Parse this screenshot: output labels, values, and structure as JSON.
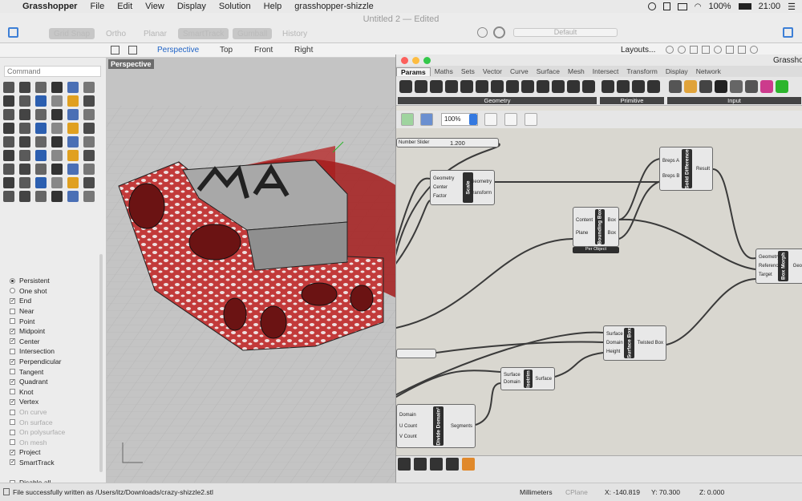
{
  "menubar": {
    "app": "Grasshopper",
    "items": [
      "File",
      "Edit",
      "View",
      "Display",
      "Solution",
      "Help",
      "grasshopper-shizzle"
    ],
    "battery": "100%",
    "time": "21:00"
  },
  "rhino": {
    "title": "Untitled 2 — Edited",
    "toolbar": [
      "Grid Snap",
      "Ortho",
      "Planar",
      "SmartTrack",
      "Gumball",
      "History"
    ],
    "layer": "Default",
    "tabs": [
      "Perspective",
      "Top",
      "Front",
      "Right"
    ],
    "layouts_label": "Layouts...",
    "command_placeholder": "Command",
    "viewport_label": "Perspective",
    "snaps": [
      {
        "label": "Persistent",
        "type": "radio",
        "on": true
      },
      {
        "label": "One shot",
        "type": "radio",
        "on": false
      },
      {
        "label": "End",
        "type": "check",
        "on": true
      },
      {
        "label": "Near",
        "type": "check",
        "on": false
      },
      {
        "label": "Point",
        "type": "check",
        "on": false
      },
      {
        "label": "Midpoint",
        "type": "check",
        "on": true
      },
      {
        "label": "Center",
        "type": "check",
        "on": true
      },
      {
        "label": "Intersection",
        "type": "check",
        "on": false
      },
      {
        "label": "Perpendicular",
        "type": "check",
        "on": true
      },
      {
        "label": "Tangent",
        "type": "check",
        "on": false
      },
      {
        "label": "Quadrant",
        "type": "check",
        "on": true
      },
      {
        "label": "Knot",
        "type": "check",
        "on": false
      },
      {
        "label": "Vertex",
        "type": "check",
        "on": true
      },
      {
        "label": "On curve",
        "type": "check",
        "on": false,
        "dim": true
      },
      {
        "label": "On surface",
        "type": "check",
        "on": false,
        "dim": true
      },
      {
        "label": "On polysurface",
        "type": "check",
        "on": false,
        "dim": true
      },
      {
        "label": "On mesh",
        "type": "check",
        "on": false,
        "dim": true
      },
      {
        "label": "Project",
        "type": "check",
        "on": true
      },
      {
        "label": "SmartTrack",
        "type": "check",
        "on": true
      },
      {
        "label": "",
        "type": "spacer"
      },
      {
        "label": "Disable all",
        "type": "check",
        "on": false
      }
    ]
  },
  "status": {
    "message": "File successfully written as /Users/itz/Downloads/crazy-shizzle2.stl",
    "units": "Millimeters",
    "cplane": "CPlane",
    "x": "X: -140.819",
    "y": "Y: 70.300",
    "z": "Z: 0.000"
  },
  "grasshopper": {
    "title": "Grassho",
    "tabs": [
      "Params",
      "Maths",
      "Sets",
      "Vector",
      "Curve",
      "Surface",
      "Mesh",
      "Intersect",
      "Transform",
      "Display",
      "Network"
    ],
    "ribbon_groups": [
      "Geometry",
      "Primitive",
      "Input"
    ],
    "zoom": "100%",
    "slider": {
      "label": "Number Slider",
      "value": "1.200"
    },
    "components": [
      {
        "id": "scale",
        "name": "Scale",
        "inputs": [
          "Geometry",
          "Center",
          "Factor"
        ],
        "outputs": [
          "Geometry",
          "Transform"
        ]
      },
      {
        "id": "bbox",
        "name": "Bounding Box",
        "inputs": [
          "Content",
          "Plane"
        ],
        "outputs": [
          "Box",
          "Box"
        ],
        "tag": "Per Object"
      },
      {
        "id": "soliddiff",
        "name": "Solid Difference",
        "inputs": [
          "Breps A",
          "Breps B"
        ],
        "outputs": [
          "Result"
        ]
      },
      {
        "id": "boxmorph",
        "name": "Box Morph",
        "inputs": [
          "Geometry",
          "Reference",
          "Target"
        ],
        "outputs": [
          "Geo"
        ]
      },
      {
        "id": "surfbox",
        "name": "Surface Box",
        "inputs": [
          "Surface",
          "Domain",
          "Height"
        ],
        "outputs": [
          "Twisted Box"
        ]
      },
      {
        "id": "isotrim",
        "name": "Isotrim",
        "inputs": [
          "Surface",
          "Domain"
        ],
        "outputs": [
          "Surface"
        ]
      },
      {
        "id": "divdomain",
        "name": "Divide Domain²",
        "inputs": [
          "Domain",
          "U Count",
          "V Count"
        ],
        "outputs": [
          "Segments"
        ]
      }
    ]
  },
  "colors": {
    "accent": "#1f63c6",
    "model_red": "#b22020",
    "gh_canvas": "#d9d7d0",
    "component_core": "#2e2e2e"
  }
}
